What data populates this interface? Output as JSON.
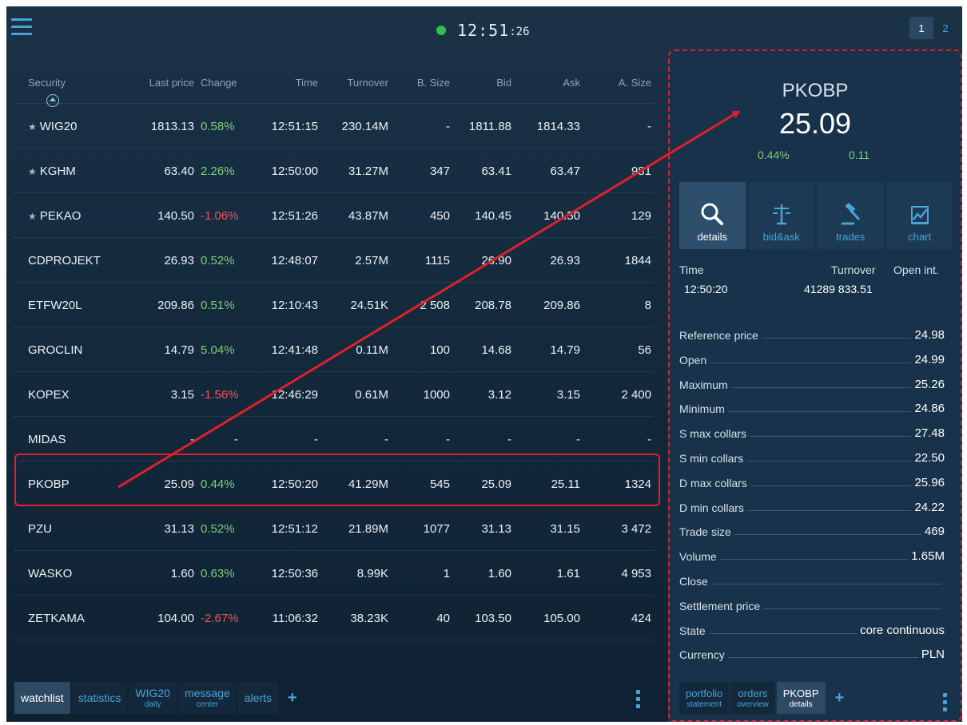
{
  "clock": {
    "time": "12:51",
    "seconds": ":26",
    "status_color": "#2ec04f"
  },
  "pages": [
    "1",
    "2"
  ],
  "table": {
    "headers": [
      "Security",
      "Last price",
      "Change",
      "Time",
      "Turnover",
      "B. Size",
      "Bid",
      "Ask",
      "A. Size"
    ],
    "rows": [
      {
        "security": "WIG20",
        "pinned": true,
        "last": "1813.13",
        "change": "0.58%",
        "dir": "up",
        "time": "12:51:15",
        "turnover": "230.14M",
        "bsize": "-",
        "bid": "1811.88",
        "ask": "1814.33",
        "asize": "-"
      },
      {
        "security": "KGHM",
        "pinned": true,
        "last": "63.40",
        "change": "2.26%",
        "dir": "up",
        "time": "12:50:00",
        "turnover": "31.27M",
        "bsize": "347",
        "bid": "63.41",
        "ask": "63.47",
        "asize": "981"
      },
      {
        "security": "PEKAO",
        "pinned": true,
        "last": "140.50",
        "change": "-1.06%",
        "dir": "down",
        "time": "12:51:26",
        "turnover": "43.87M",
        "bsize": "450",
        "bid": "140.45",
        "ask": "140.50",
        "asize": "129"
      },
      {
        "security": "CDPROJEKT",
        "pinned": false,
        "last": "26.93",
        "change": "0.52%",
        "dir": "up",
        "time": "12:48:07",
        "turnover": "2.57M",
        "bsize": "1115",
        "bid": "26.90",
        "ask": "26.93",
        "asize": "1844"
      },
      {
        "security": "ETFW20L",
        "pinned": false,
        "last": "209.86",
        "change": "0.51%",
        "dir": "up",
        "time": "12:10:43",
        "turnover": "24.51K",
        "bsize": "2 508",
        "bid": "208.78",
        "ask": "209.86",
        "asize": "8"
      },
      {
        "security": "GROCLIN",
        "pinned": false,
        "last": "14.79",
        "change": "5.04%",
        "dir": "up",
        "time": "12:41:48",
        "turnover": "0.11M",
        "bsize": "100",
        "bid": "14.68",
        "ask": "14.79",
        "asize": "56"
      },
      {
        "security": "KOPEX",
        "pinned": false,
        "last": "3.15",
        "change": "-1.56%",
        "dir": "down",
        "time": "12:46:29",
        "turnover": "0.61M",
        "bsize": "1000",
        "bid": "3.12",
        "ask": "3.15",
        "asize": "2 400"
      },
      {
        "security": "MIDAS",
        "pinned": false,
        "last": "-",
        "change": "-",
        "dir": "none",
        "time": "-",
        "turnover": "-",
        "bsize": "-",
        "bid": "-",
        "ask": "-",
        "asize": "-"
      },
      {
        "security": "PKOBP",
        "pinned": false,
        "last": "25.09",
        "change": "0.44%",
        "dir": "up",
        "time": "12:50:20",
        "turnover": "41.29M",
        "bsize": "545",
        "bid": "25.09",
        "ask": "25.11",
        "asize": "1324"
      },
      {
        "security": "PZU",
        "pinned": false,
        "last": "31.13",
        "change": "0.52%",
        "dir": "up",
        "time": "12:51:12",
        "turnover": "21.89M",
        "bsize": "1077",
        "bid": "31.13",
        "ask": "31.15",
        "asize": "3 472"
      },
      {
        "security": "WASKO",
        "pinned": false,
        "last": "1.60",
        "change": "0.63%",
        "dir": "up",
        "time": "12:50:36",
        "turnover": "8.99K",
        "bsize": "1",
        "bid": "1.60",
        "ask": "1.61",
        "asize": "4 953"
      },
      {
        "security": "ZETKAMA",
        "pinned": false,
        "last": "104.00",
        "change": "-2.67%",
        "dir": "down",
        "time": "11:06:32",
        "turnover": "38.23K",
        "bsize": "40",
        "bid": "103.50",
        "ask": "105.00",
        "asize": "424"
      }
    ]
  },
  "bottom_tabs": [
    {
      "label": "watchlist",
      "sub": "",
      "active": true
    },
    {
      "label": "statistics",
      "sub": "",
      "active": false
    },
    {
      "label": "WIG20",
      "sub": "daily",
      "active": false
    },
    {
      "label": "message",
      "sub": "center",
      "active": false
    },
    {
      "label": "alerts",
      "sub": "",
      "active": false
    }
  ],
  "add_label": "+",
  "panel": {
    "symbol": "PKOBP",
    "price": "25.09",
    "change_pct": "0.44%",
    "change_abs": "0.11",
    "actions": [
      {
        "label": "details",
        "icon": "magnifier-icon",
        "active": true
      },
      {
        "label": "bid&ask",
        "icon": "scales-icon",
        "active": false
      },
      {
        "label": "trades",
        "icon": "gavel-icon",
        "active": false
      },
      {
        "label": "chart",
        "icon": "chart-icon",
        "active": false
      }
    ],
    "time_label": "Time",
    "time_value": "12:50:20",
    "turnover_label": "Turnover",
    "turnover_value": "41289 833.51",
    "open_int_label": "Open int.",
    "stats": [
      {
        "label": "Reference price",
        "value": "24.98"
      },
      {
        "label": "Open",
        "value": "24.99"
      },
      {
        "label": "Maximum",
        "value": "25.26"
      },
      {
        "label": "Minimum",
        "value": "24.86"
      },
      {
        "label": "S max collars",
        "value": "27.48"
      },
      {
        "label": "S min collars",
        "value": "22.50"
      },
      {
        "label": "D max collars",
        "value": "25.96"
      },
      {
        "label": "D min collars",
        "value": "24.22"
      },
      {
        "label": "Trade size",
        "value": "469"
      },
      {
        "label": "Volume",
        "value": "1.65M"
      },
      {
        "label": "Close",
        "value": ""
      },
      {
        "label": "Settlement price",
        "value": ""
      },
      {
        "label": "State",
        "value": "core continuous"
      },
      {
        "label": "Currency",
        "value": "PLN"
      }
    ],
    "tabs": [
      {
        "label": "portfolio",
        "sub": "statement",
        "active": false
      },
      {
        "label": "orders",
        "sub": "overview",
        "active": false
      },
      {
        "label": "PKOBP",
        "sub": "details",
        "active": true
      }
    ]
  },
  "colors": {
    "positive": "#7fcf7a",
    "negative": "#f0545a",
    "accent": "#4aa3d9",
    "annotation": "#e0202a"
  }
}
